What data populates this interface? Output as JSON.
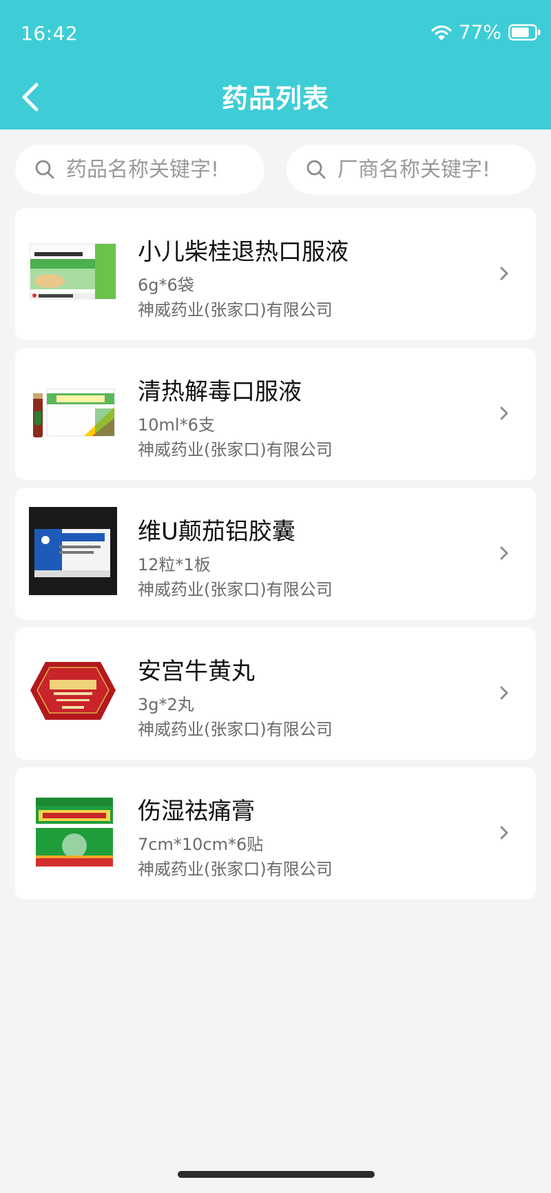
{
  "status_bar": {
    "time": "16:42",
    "battery": "77%",
    "battery_level": 0.77,
    "wifi_icon": "wifi-icon",
    "battery_icon": "battery-icon"
  },
  "header": {
    "title": "药品列表",
    "back_icon": "back-chevron-icon",
    "background_color": "#3ecdd6"
  },
  "search": {
    "drug_placeholder": "药品名称关键字!",
    "vendor_placeholder": "厂商名称关键字!",
    "icon": "search-icon"
  },
  "drugs": [
    {
      "name": "小儿柴桂退热口服液",
      "spec": "6g*6袋",
      "company": "神威药业(张家口)有限公司",
      "thumb": "green-white-box"
    },
    {
      "name": "清热解毒口服液",
      "spec": "10ml*6支",
      "company": "神威药业(张家口)有限公司",
      "thumb": "green-box-with-vial"
    },
    {
      "name": "维U颠茄铝胶囊",
      "spec": "12粒*1板",
      "company": "神威药业(张家口)有限公司",
      "thumb": "blue-white-box"
    },
    {
      "name": "安宫牛黄丸",
      "spec": "3g*2丸",
      "company": "神威药业(张家口)有限公司",
      "thumb": "red-hexagon-tin"
    },
    {
      "name": "伤湿祛痛膏",
      "spec": "7cm*10cm*6贴",
      "company": "神威药业(张家口)有限公司",
      "thumb": "green-red-box"
    }
  ],
  "item_chevron_icon": "chevron-right-icon"
}
